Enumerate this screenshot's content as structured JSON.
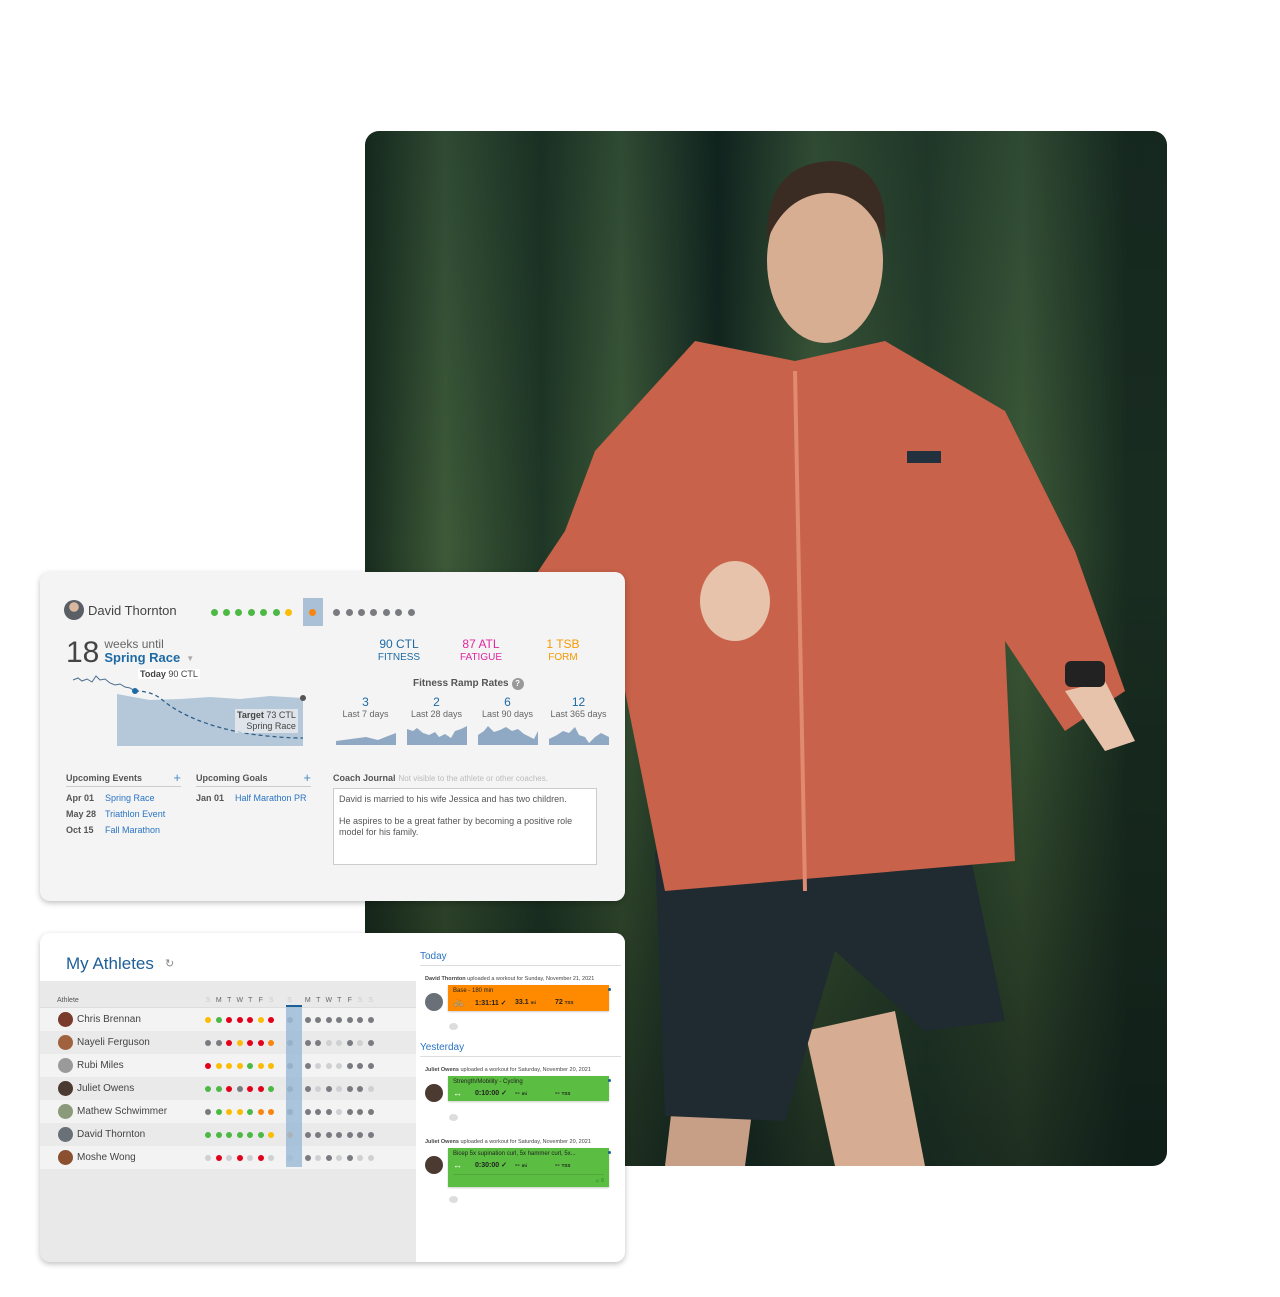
{
  "photo": {
    "subject": "runner-in-forest",
    "colors": {
      "jacket": "#c8624a",
      "shorts": "#1f2b30",
      "forest": "#2f4a33"
    }
  },
  "athlete_card": {
    "athlete_name": "David Thornton",
    "week_dots": {
      "before": [
        "green",
        "green",
        "green",
        "green",
        "green",
        "green",
        "yellow"
      ],
      "today": "orange",
      "after": [
        "gray",
        "gray",
        "gray",
        "gray",
        "gray",
        "gray",
        "gray"
      ]
    },
    "countdown": {
      "weeks": "18",
      "label": "weeks until",
      "event": "Spring Race",
      "caret": "▼"
    },
    "ctl_chart": {
      "today_label_bold": "Today",
      "today_label_value": "90 CTL",
      "target_label_bold": "Target",
      "target_label_value": "73 CTL",
      "target_event": "Spring Race",
      "today_ctl": 90,
      "target_ctl": 73
    },
    "metrics": [
      {
        "value": "90 CTL",
        "label": "FITNESS",
        "color": "#1d6aa5"
      },
      {
        "value": "87 ATL",
        "label": "FATIGUE",
        "color": "#e0269e"
      },
      {
        "value": "1 TSB",
        "label": "FORM",
        "color": "#f59a00"
      }
    ],
    "ramp_title": "Fitness Ramp Rates",
    "help_icon": "?",
    "ramp_rates": [
      {
        "value": "3",
        "label": "Last 7 days"
      },
      {
        "value": "2",
        "label": "Last 28 days"
      },
      {
        "value": "6",
        "label": "Last 90 days"
      },
      {
        "value": "12",
        "label": "Last 365 days"
      }
    ],
    "upcoming_events": {
      "title": "Upcoming Events",
      "add_icon": "+",
      "items": [
        {
          "date": "Apr 01",
          "name": "Spring Race"
        },
        {
          "date": "May 28",
          "name": "Triathlon Event"
        },
        {
          "date": "Oct 15",
          "name": "Fall Marathon"
        }
      ]
    },
    "upcoming_goals": {
      "title": "Upcoming Goals",
      "add_icon": "+",
      "items": [
        {
          "date": "Jan 01",
          "name": "Half Marathon PR"
        }
      ]
    },
    "coach_journal": {
      "title": "Coach Journal",
      "note": "Not visible to the athlete or other coaches.",
      "paragraphs": [
        "David is married to his wife Jessica and has two children.",
        "He aspires to be a great father by becoming a positive role model for his family."
      ]
    }
  },
  "athletes_card": {
    "title": "My Athletes",
    "refresh_icon": "↻",
    "column_athlete": "Athlete",
    "day_letters_before": [
      "S",
      "M",
      "T",
      "W",
      "T",
      "F",
      "S"
    ],
    "day_letter_today": "S",
    "day_letters_after": [
      "M",
      "T",
      "W",
      "T",
      "F",
      "S",
      "S"
    ],
    "colors": {
      "green": "#4cb944",
      "yellow": "#fbbc05",
      "red": "#e2001a",
      "orange": "#f98511",
      "gray": "#7a7b80",
      "lightgray": "#cfd0d2"
    },
    "athletes": [
      {
        "name": "Chris Brennan",
        "before": [
          "yellow",
          "green",
          "red",
          "red",
          "red",
          "yellow",
          "red"
        ],
        "today": "gray",
        "after": [
          "gray",
          "gray",
          "gray",
          "gray",
          "gray",
          "gray",
          "gray"
        ]
      },
      {
        "name": "Nayeli Ferguson",
        "before": [
          "gray",
          "gray",
          "red",
          "yellow",
          "red",
          "red",
          "orange"
        ],
        "today": "gray",
        "after": [
          "gray",
          "gray",
          "lightgray",
          "lightgray",
          "gray",
          "lightgray",
          "gray"
        ]
      },
      {
        "name": "Rubi Miles",
        "before": [
          "red",
          "yellow",
          "yellow",
          "yellow",
          "green",
          "yellow",
          "yellow"
        ],
        "today": "gray",
        "after": [
          "gray",
          "lightgray",
          "lightgray",
          "lightgray",
          "gray",
          "gray",
          "gray"
        ]
      },
      {
        "name": "Juliet Owens",
        "before": [
          "green",
          "green",
          "red",
          "gray",
          "red",
          "red",
          "green"
        ],
        "today": "gray",
        "after": [
          "gray",
          "lightgray",
          "gray",
          "lightgray",
          "gray",
          "gray",
          "lightgray"
        ]
      },
      {
        "name": "Mathew Schwimmer",
        "before": [
          "gray",
          "green",
          "yellow",
          "yellow",
          "green",
          "orange",
          "orange"
        ],
        "today": "gray",
        "after": [
          "gray",
          "gray",
          "gray",
          "lightgray",
          "gray",
          "gray",
          "gray"
        ]
      },
      {
        "name": "David Thornton",
        "before": [
          "green",
          "green",
          "green",
          "green",
          "green",
          "green",
          "yellow"
        ],
        "today": "orange",
        "after": [
          "gray",
          "gray",
          "gray",
          "gray",
          "gray",
          "gray",
          "gray"
        ]
      },
      {
        "name": "Moshe Wong",
        "before": [
          "lightgray",
          "red",
          "lightgray",
          "red",
          "lightgray",
          "red",
          "lightgray"
        ],
        "today": "lightgray",
        "after": [
          "gray",
          "lightgray",
          "gray",
          "lightgray",
          "gray",
          "lightgray",
          "lightgray"
        ]
      }
    ],
    "feed": [
      {
        "heading": "Today",
        "items": [
          {
            "user": "David Thornton",
            "text": "uploaded a workout for Sunday, November 21, 2021",
            "color": "orange",
            "title": "Base - 180 min",
            "sport_icon": "bike-icon",
            "sport_glyph": "🚲",
            "duration": "1:31:11",
            "distance": "33.1",
            "distance_unit": "mi",
            "tss": "72",
            "tss_unit": "TSS"
          }
        ]
      },
      {
        "heading": "Yesterday",
        "items": [
          {
            "user": "Juliet Owens",
            "text": "uploaded a workout for Saturday, November 20, 2021",
            "color": "green",
            "title": "Strength/Mobility - Cycling",
            "sport_icon": "strength-icon",
            "sport_glyph": "↔",
            "duration": "0:10:00",
            "distance": "--",
            "distance_unit": "mi",
            "tss": "--",
            "tss_unit": "TSS"
          },
          {
            "user": "Juliet Owens",
            "text": "uploaded a workout for Saturday, November 20, 2021",
            "color": "green",
            "title": "Bicep 5x supination curl, 5x hammer curl, 5x...",
            "sport_icon": "strength-icon",
            "sport_glyph": "↔",
            "duration": "0:30:00",
            "distance": "--",
            "distance_unit": "mi",
            "tss": "--",
            "tss_unit": "TSS",
            "footer": "☺ 6"
          }
        ]
      }
    ]
  }
}
